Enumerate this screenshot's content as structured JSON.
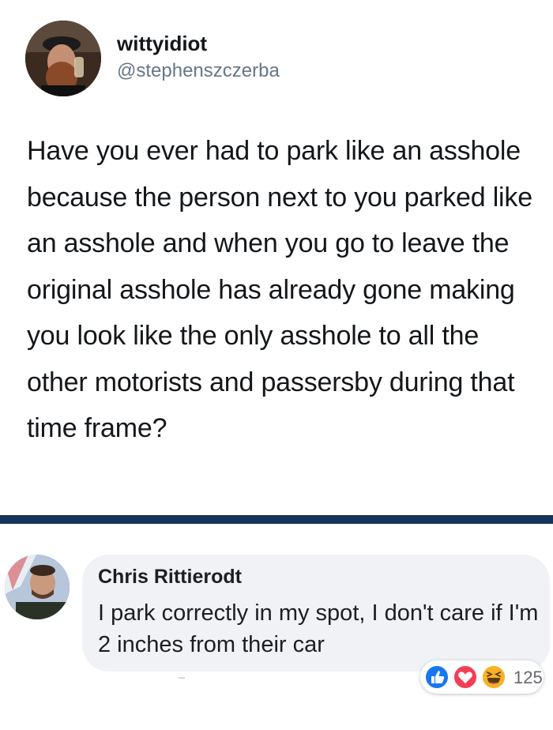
{
  "tweet": {
    "display_name": "wittyidiot",
    "handle": "@stephenszczerba",
    "text": "Have you ever had to park like an asshole because the person next to you parked like an asshole and when you go to leave the original asshole has already gone making you look like the only asshole to all the other motorists and passersby during that time frame?"
  },
  "comment": {
    "author": "Chris Rittierodt",
    "text": "I park correctly in my spot, I don't care if I'm 2 inches from their car",
    "reactions": {
      "icons": [
        "like-icon",
        "love-icon",
        "haha-icon"
      ],
      "count": "125"
    }
  },
  "colors": {
    "divider": "#14345c",
    "like": "#1877f2",
    "love": "#f33e58",
    "haha": "#f7b125",
    "bubble": "#f0f2f5"
  }
}
